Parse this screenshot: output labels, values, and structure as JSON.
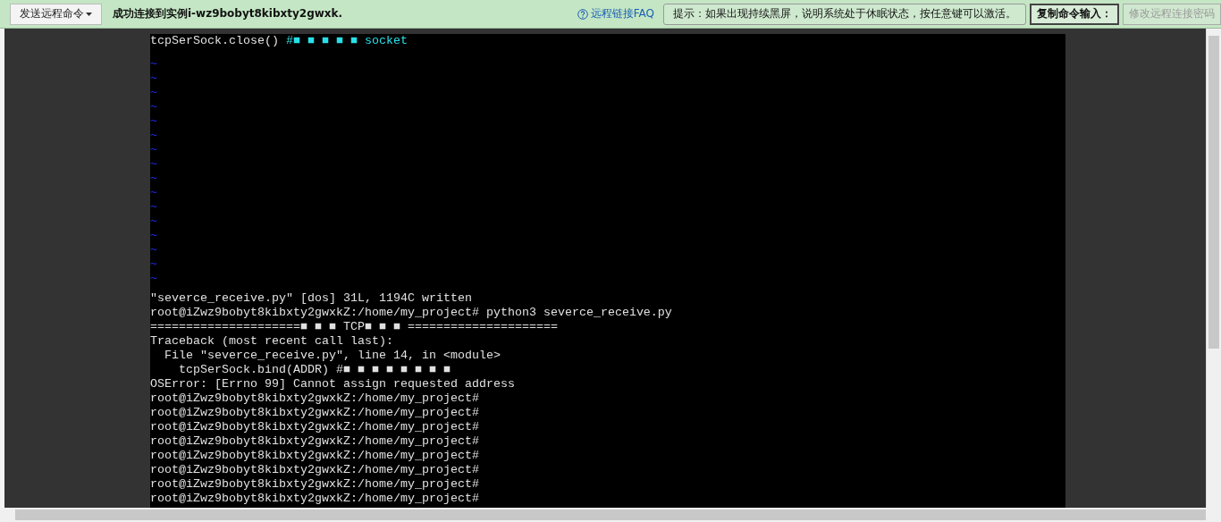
{
  "toolbar": {
    "send_menu": "发送远程命令",
    "status": "成功连接到实例i-wz9bobyt8kibxty2gwxk.",
    "faq_link": "远程链接FAQ",
    "hint": "提示：如果出现持续黑屏，说明系统处于休眠状态，按任意键可以激活。",
    "copy_button": "复制命令输入：",
    "password_button": {
      "label": "修改远程连接密码",
      "disabled": true
    }
  },
  "terminal": {
    "lines": [
      {
        "kind": "code",
        "text": "tcpSerSock.close() ",
        "comment": "#■ ■ ■ ■ ■ socket"
      },
      {
        "kind": "tilde",
        "text": "~"
      },
      {
        "kind": "tilde",
        "text": "~"
      },
      {
        "kind": "tilde",
        "text": "~"
      },
      {
        "kind": "tilde",
        "text": "~"
      },
      {
        "kind": "tilde",
        "text": "~"
      },
      {
        "kind": "tilde",
        "text": "~"
      },
      {
        "kind": "tilde",
        "text": "~"
      },
      {
        "kind": "tilde",
        "text": "~"
      },
      {
        "kind": "tilde",
        "text": "~"
      },
      {
        "kind": "tilde",
        "text": "~"
      },
      {
        "kind": "tilde",
        "text": "~"
      },
      {
        "kind": "tilde",
        "text": "~"
      },
      {
        "kind": "tilde",
        "text": "~"
      },
      {
        "kind": "tilde",
        "text": "~"
      },
      {
        "kind": "tilde",
        "text": "~"
      },
      {
        "kind": "tilde",
        "text": "~"
      },
      {
        "kind": "text",
        "text": "\"severce_receive.py\" [dos] 31L, 1194C written"
      },
      {
        "kind": "text",
        "text": "root@iZwz9bobyt8kibxty2gwxkZ:/home/my_project# python3 severce_receive.py"
      },
      {
        "kind": "text",
        "text": "=====================■ ■ ■ TCP■ ■ ■ ====================="
      },
      {
        "kind": "text",
        "text": "Traceback (most recent call last):"
      },
      {
        "kind": "text",
        "text": "  File \"severce_receive.py\", line 14, in <module>"
      },
      {
        "kind": "text",
        "text": "    tcpSerSock.bind(ADDR) #■ ■ ■ ■ ■ ■ ■ ■"
      },
      {
        "kind": "text",
        "text": "OSError: [Errno 99] Cannot assign requested address"
      },
      {
        "kind": "text",
        "text": "root@iZwz9bobyt8kibxty2gwxkZ:/home/my_project#"
      },
      {
        "kind": "text",
        "text": "root@iZwz9bobyt8kibxty2gwxkZ:/home/my_project#"
      },
      {
        "kind": "text",
        "text": "root@iZwz9bobyt8kibxty2gwxkZ:/home/my_project#"
      },
      {
        "kind": "text",
        "text": "root@iZwz9bobyt8kibxty2gwxkZ:/home/my_project#"
      },
      {
        "kind": "text",
        "text": "root@iZwz9bobyt8kibxty2gwxkZ:/home/my_project#"
      },
      {
        "kind": "text",
        "text": "root@iZwz9bobyt8kibxty2gwxkZ:/home/my_project#"
      },
      {
        "kind": "text",
        "text": "root@iZwz9bobyt8kibxty2gwxkZ:/home/my_project#"
      },
      {
        "kind": "text",
        "text": "root@iZwz9bobyt8kibxty2gwxkZ:/home/my_project#"
      }
    ]
  }
}
